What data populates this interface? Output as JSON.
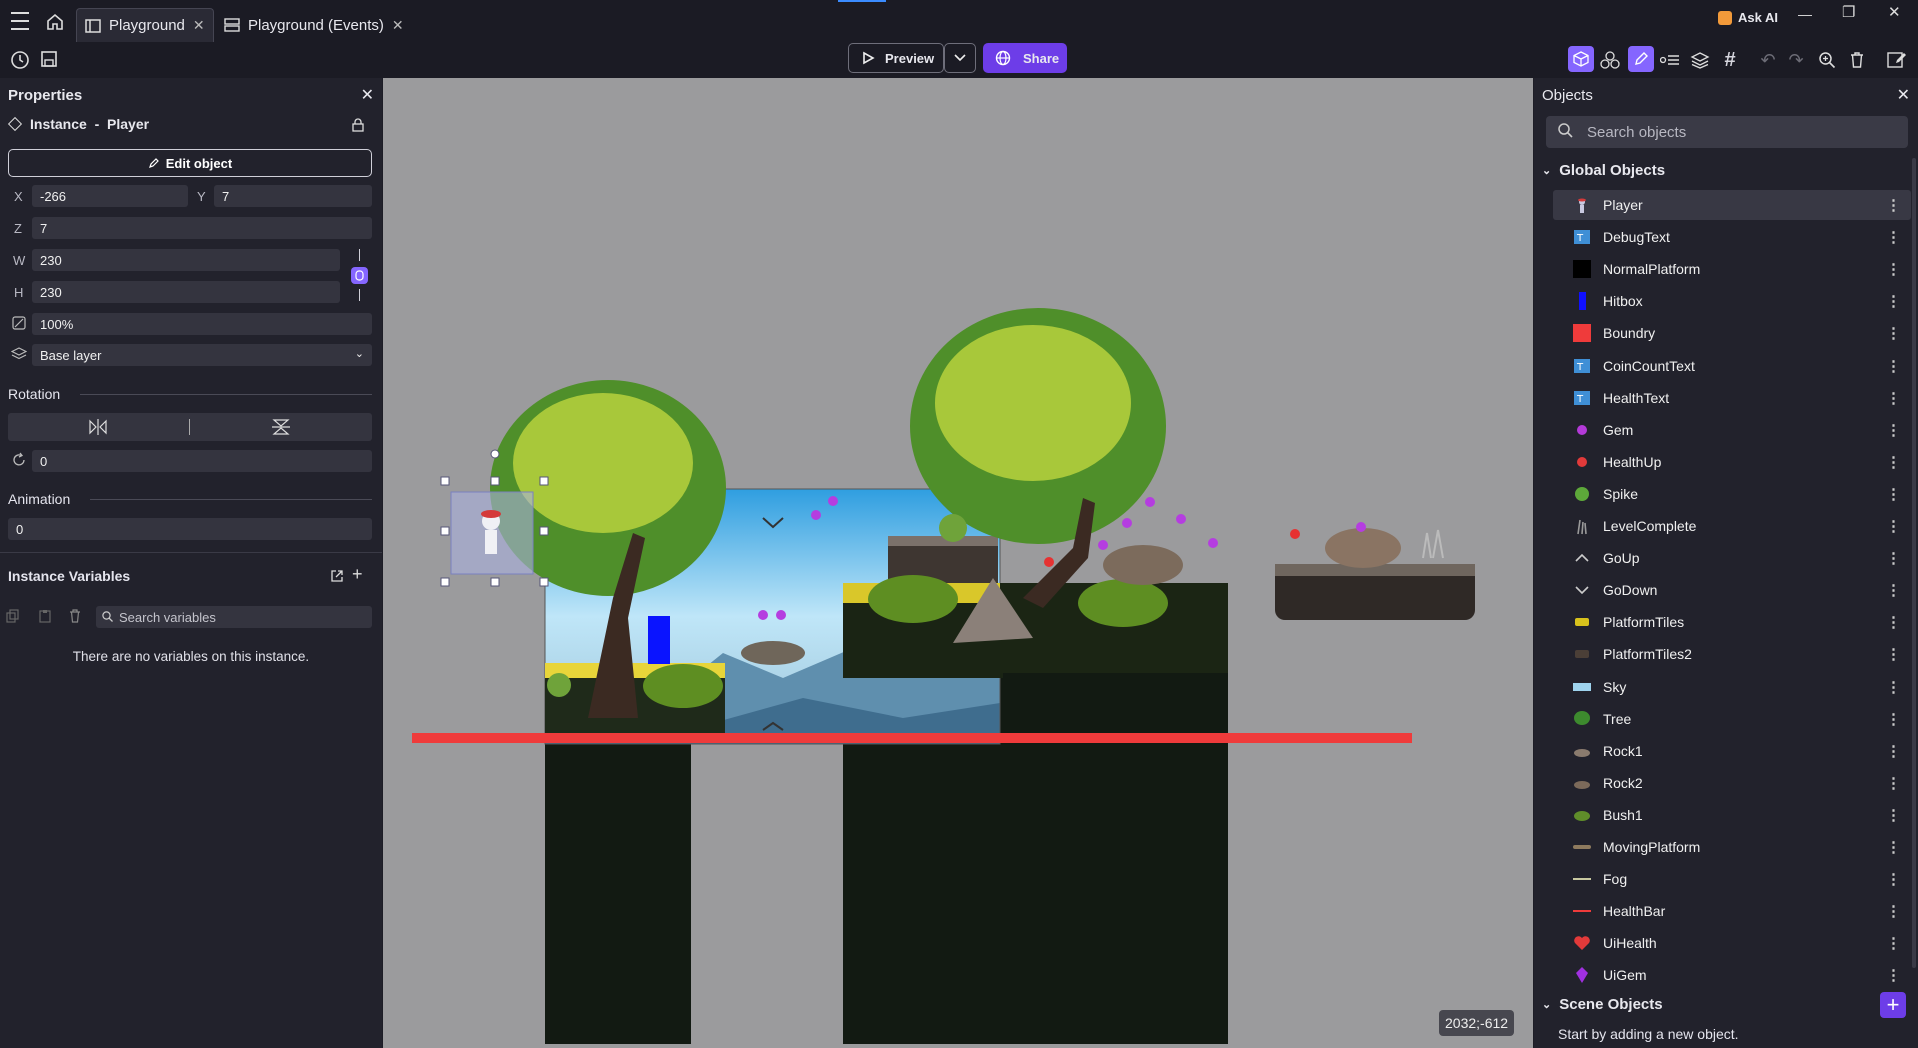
{
  "tabs": [
    {
      "label": "Playground",
      "active": true
    },
    {
      "label": "Playground (Events)",
      "active": false
    }
  ],
  "titlebar": {
    "ask_ai": "Ask AI"
  },
  "toolbar": {
    "preview": "Preview",
    "share": "Share"
  },
  "properties": {
    "title": "Properties",
    "instance_label": "Instance  -  Player",
    "edit_object": "Edit object",
    "x_label": "X",
    "x_value": "-266",
    "y_label": "Y",
    "y_value": "7",
    "z_label": "Z",
    "z_value": "7",
    "w_label": "W",
    "w_value": "230",
    "h_label": "H",
    "h_value": "230",
    "opacity_value": "100%",
    "layer_value": "Base layer",
    "rotation_heading": "Rotation",
    "rotation_value": "0",
    "animation_heading": "Animation",
    "animation_value": "0",
    "instance_vars_heading": "Instance Variables",
    "search_vars_placeholder": "Search variables",
    "no_vars": "There are no variables on this instance."
  },
  "objects": {
    "title": "Objects",
    "search_placeholder": "Search objects",
    "global_heading": "Global Objects",
    "items": [
      {
        "name": "Player",
        "icon": "player-sprite",
        "color": "#c9c9e0"
      },
      {
        "name": "DebugText",
        "icon": "text-icon",
        "color": "#3f8fd6"
      },
      {
        "name": "NormalPlatform",
        "icon": "black-square",
        "color": "#000000"
      },
      {
        "name": "Hitbox",
        "icon": "blue-bar",
        "color": "#1010ff"
      },
      {
        "name": "Boundry",
        "icon": "red-square",
        "color": "#ef3b3b"
      },
      {
        "name": "CoinCountText",
        "icon": "text-icon",
        "color": "#3f8fd6"
      },
      {
        "name": "HealthText",
        "icon": "text-icon",
        "color": "#3f8fd6"
      },
      {
        "name": "Gem",
        "icon": "gem-dot",
        "color": "#b43ad9"
      },
      {
        "name": "HealthUp",
        "icon": "health-dot",
        "color": "#e23a3a"
      },
      {
        "name": "Spike",
        "icon": "melon",
        "color": "#5da83a"
      },
      {
        "name": "LevelComplete",
        "icon": "grass",
        "color": "#9a9a9a"
      },
      {
        "name": "GoUp",
        "icon": "chevron-up",
        "color": "#cccccc"
      },
      {
        "name": "GoDown",
        "icon": "chevron-down",
        "color": "#cccccc"
      },
      {
        "name": "PlatformTiles",
        "icon": "tile",
        "color": "#d8c21c"
      },
      {
        "name": "PlatformTiles2",
        "icon": "tile",
        "color": "#4b3f37"
      },
      {
        "name": "Sky",
        "icon": "sky",
        "color": "#9fd4ee"
      },
      {
        "name": "Tree",
        "icon": "tree",
        "color": "#3d8a2e"
      },
      {
        "name": "Rock1",
        "icon": "rock",
        "color": "#8a7b6e"
      },
      {
        "name": "Rock2",
        "icon": "rock",
        "color": "#7c6a5a"
      },
      {
        "name": "Bush1",
        "icon": "bush",
        "color": "#5f8d2a"
      },
      {
        "name": "MovingPlatform",
        "icon": "platform",
        "color": "#8e7a5e"
      },
      {
        "name": "Fog",
        "icon": "line",
        "color": "#c8c8a0"
      },
      {
        "name": "HealthBar",
        "icon": "line",
        "color": "#ef3b3b"
      },
      {
        "name": "UiHealth",
        "icon": "heart",
        "color": "#e23a3a"
      },
      {
        "name": "UiGem",
        "icon": "gem",
        "color": "#a030e0"
      }
    ],
    "scene_heading": "Scene Objects",
    "scene_empty": "Start by adding a new object."
  },
  "canvas": {
    "coords": "2032;-612"
  },
  "colors": {
    "accent": "#7c4dff",
    "bg": "#22222c",
    "canvas": "#9b9b9d"
  }
}
